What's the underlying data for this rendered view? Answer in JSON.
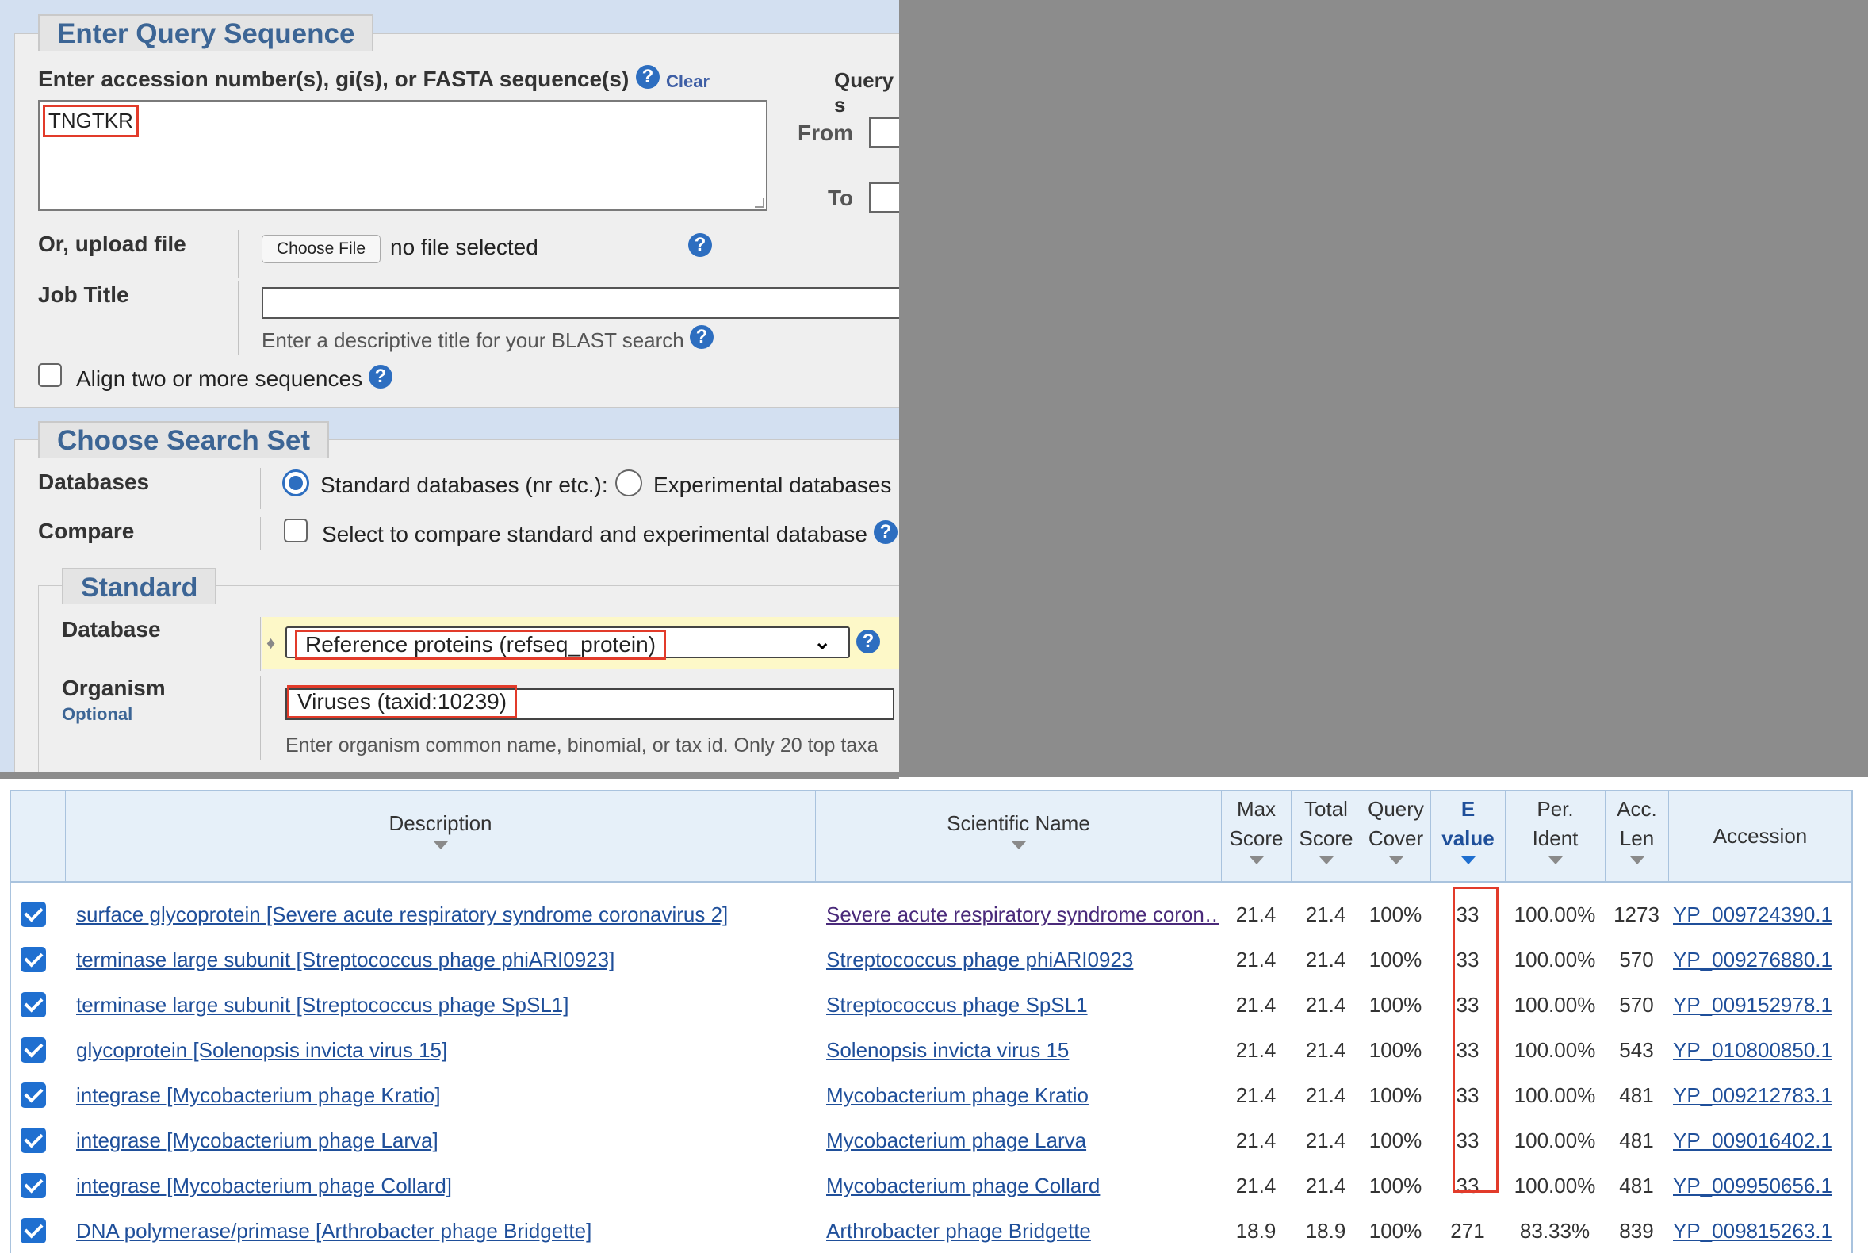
{
  "query_section": {
    "legend": "Enter Query Sequence",
    "accession_label": "Enter accession number(s), gi(s), or FASTA sequence(s)",
    "clear_label": "Clear",
    "sequence_value": "TNGTKR",
    "subrange_label": "Query s",
    "from_label": "From",
    "to_label": "To",
    "upload_label": "Or, upload file",
    "choose_file_label": "Choose File",
    "no_file_text": "no file selected",
    "job_title_label": "Job Title",
    "job_title_hint": "Enter a descriptive title for your BLAST search",
    "align_two_label": "Align two or more sequences"
  },
  "search_set": {
    "legend": "Choose Search Set",
    "databases_label": "Databases",
    "standard_db_option": "Standard databases (nr etc.):",
    "experimental_db_option": "Experimental databases",
    "compare_label": "Compare",
    "compare_option": "Select to compare standard and experimental database",
    "standard_legend": "Standard",
    "database_label": "Database",
    "database_value": "Reference proteins (refseq_protein)",
    "organism_label": "Organism",
    "organism_optional": "Optional",
    "organism_value": "Viruses (taxid:10239)",
    "organism_hint": "Enter organism common name, binomial, or tax id. Only 20 top taxa"
  },
  "results": {
    "headers": {
      "description": "Description",
      "scientific_name": "Scientific Name",
      "max_score_1": "Max",
      "max_score_2": "Score",
      "total_score_1": "Total",
      "total_score_2": "Score",
      "query_cover_1": "Query",
      "query_cover_2": "Cover",
      "e_value_1": "E",
      "e_value_2": "value",
      "per_ident_1": "Per.",
      "per_ident_2": "Ident",
      "acc_len_1": "Acc.",
      "acc_len_2": "Len",
      "accession": "Accession"
    },
    "rows": [
      {
        "description": "surface glycoprotein [Severe acute respiratory syndrome coronavirus 2]",
        "scientific_name": "Severe acute respiratory syndrome coron…",
        "max_score": "21.4",
        "total_score": "21.4",
        "query_cover": "100%",
        "e_value": "33",
        "per_ident": "100.00%",
        "acc_len": "1273",
        "accession": "YP_009724390.1"
      },
      {
        "description": "terminase large subunit [Streptococcus phage phiARI0923]",
        "scientific_name": "Streptococcus phage phiARI0923",
        "max_score": "21.4",
        "total_score": "21.4",
        "query_cover": "100%",
        "e_value": "33",
        "per_ident": "100.00%",
        "acc_len": "570",
        "accession": "YP_009276880.1"
      },
      {
        "description": "terminase large subunit [Streptococcus phage SpSL1]",
        "scientific_name": "Streptococcus phage SpSL1",
        "max_score": "21.4",
        "total_score": "21.4",
        "query_cover": "100%",
        "e_value": "33",
        "per_ident": "100.00%",
        "acc_len": "570",
        "accession": "YP_009152978.1"
      },
      {
        "description": "glycoprotein [Solenopsis invicta virus 15]",
        "scientific_name": "Solenopsis invicta virus 15",
        "max_score": "21.4",
        "total_score": "21.4",
        "query_cover": "100%",
        "e_value": "33",
        "per_ident": "100.00%",
        "acc_len": "543",
        "accession": "YP_010800850.1"
      },
      {
        "description": "integrase [Mycobacterium phage Kratio]",
        "scientific_name": "Mycobacterium phage Kratio",
        "max_score": "21.4",
        "total_score": "21.4",
        "query_cover": "100%",
        "e_value": "33",
        "per_ident": "100.00%",
        "acc_len": "481",
        "accession": "YP_009212783.1"
      },
      {
        "description": "integrase [Mycobacterium phage Larva]",
        "scientific_name": "Mycobacterium phage Larva",
        "max_score": "21.4",
        "total_score": "21.4",
        "query_cover": "100%",
        "e_value": "33",
        "per_ident": "100.00%",
        "acc_len": "481",
        "accession": "YP_009016402.1"
      },
      {
        "description": "integrase [Mycobacterium phage Collard]",
        "scientific_name": "Mycobacterium phage Collard",
        "max_score": "21.4",
        "total_score": "21.4",
        "query_cover": "100%",
        "e_value": "33",
        "per_ident": "100.00%",
        "acc_len": "481",
        "accession": "YP_009950656.1"
      },
      {
        "description": "DNA polymerase/primase [Arthrobacter phage Bridgette]",
        "scientific_name": "Arthrobacter phage Bridgette",
        "max_score": "18.9",
        "total_score": "18.9",
        "query_cover": "100%",
        "e_value": "271",
        "per_ident": "83.33%",
        "acc_len": "839",
        "accession": "YP_009815263.1"
      }
    ]
  },
  "colors": {
    "link": "#1f4f9a",
    "highlight_box": "#e23b2a",
    "legend_text": "#3c6595",
    "header_bg": "#e6f0f9"
  }
}
